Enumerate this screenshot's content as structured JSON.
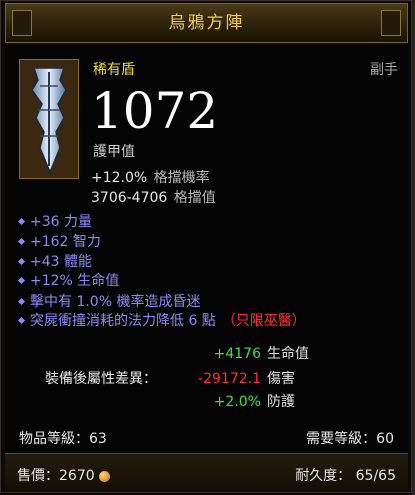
{
  "header": {
    "title": "烏鴉方陣"
  },
  "item": {
    "rarity_type": "稀有盾",
    "slot": "副手",
    "armor_value": "1072",
    "armor_label": "護甲值",
    "block_chance": "+12.0%",
    "block_chance_label": "格擋機率",
    "block_amount": "3706-4706",
    "block_amount_label": "格擋值"
  },
  "affixes": [
    {
      "text": "+36 力量"
    },
    {
      "text": "+162 智力"
    },
    {
      "text": "+43 體能"
    },
    {
      "text": "+12% 生命值"
    },
    {
      "text": "擊中有 1.0% 機率造成昏迷"
    },
    {
      "text": "突屍衝撞消耗的法力降低 6 點",
      "restriction": "（只限巫醫）"
    }
  ],
  "comparison": {
    "label": "裝備後屬性差異：",
    "rows": [
      {
        "value": "+4176",
        "stat": "生命值",
        "sign": "pos"
      },
      {
        "value": "-29172.1",
        "stat": "傷害",
        "sign": "neg"
      },
      {
        "value": "+2.0%",
        "stat": "防護",
        "sign": "pos"
      }
    ]
  },
  "levels": {
    "item_level": "物品等級：63",
    "required_level": "需要等級：60"
  },
  "footer": {
    "price_label": "售價：",
    "price": "2670",
    "durability_label": "耐久度：",
    "durability": "65/65"
  },
  "colors": {
    "title": "#f4cf4a",
    "rare": "#f0df2a",
    "magic": "#8a8af4",
    "positive": "#3ce13c",
    "negative": "#ff3030"
  },
  "icons": {
    "item": "shield-icon",
    "currency": "gold-coin-icon"
  }
}
